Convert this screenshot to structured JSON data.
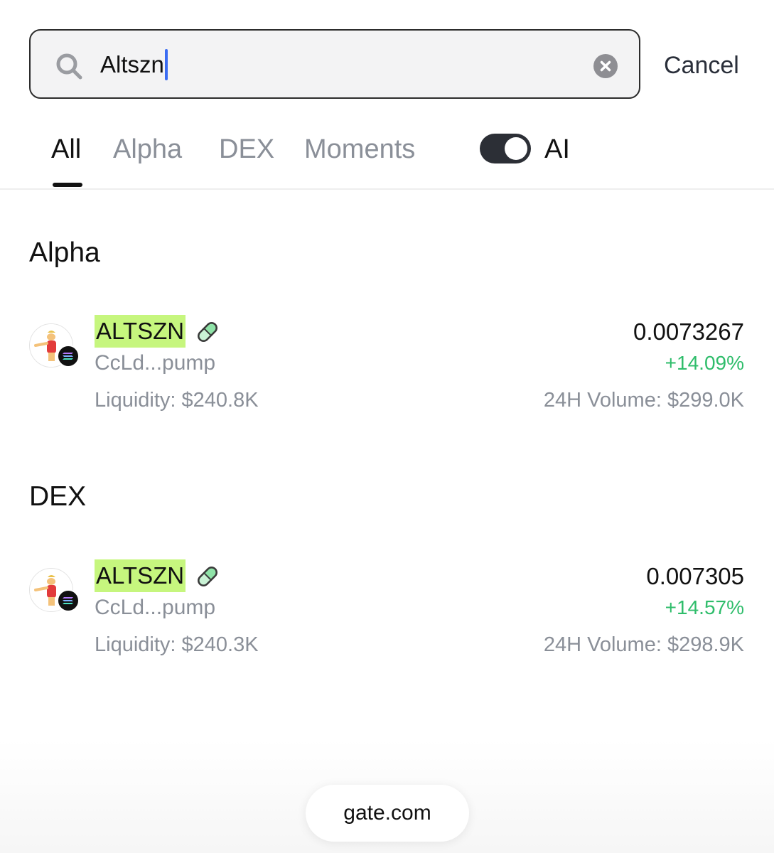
{
  "search": {
    "value": "Altszn",
    "clear_icon": "clear-circle-icon",
    "cancel_label": "Cancel"
  },
  "tabs": [
    {
      "label": "All",
      "active": true
    },
    {
      "label": "Alpha",
      "active": false
    },
    {
      "label": "DEX",
      "active": false
    },
    {
      "label": "Moments",
      "active": false
    }
  ],
  "ai_toggle": {
    "label": "AI",
    "on": true
  },
  "sections": {
    "alpha": {
      "title": "Alpha",
      "items": [
        {
          "symbol": "ALTSZN",
          "address": "CcLd...pump",
          "liquidity": "Liquidity: $240.8K",
          "price": "0.0073267",
          "change": "+14.09%",
          "volume": "24H Volume: $299.0K"
        }
      ]
    },
    "dex": {
      "title": "DEX",
      "items": [
        {
          "symbol": "ALTSZN",
          "address": "CcLd...pump",
          "liquidity": "Liquidity: $240.3K",
          "price": "0.007305",
          "change": "+14.57%",
          "volume": "24H Volume: $298.9K"
        }
      ]
    }
  },
  "footer": {
    "domain": "gate.com"
  },
  "colors": {
    "highlight": "#c6f67e",
    "positive": "#2fbd6b",
    "caret": "#3b6cf2",
    "muted": "#8a8f98"
  }
}
